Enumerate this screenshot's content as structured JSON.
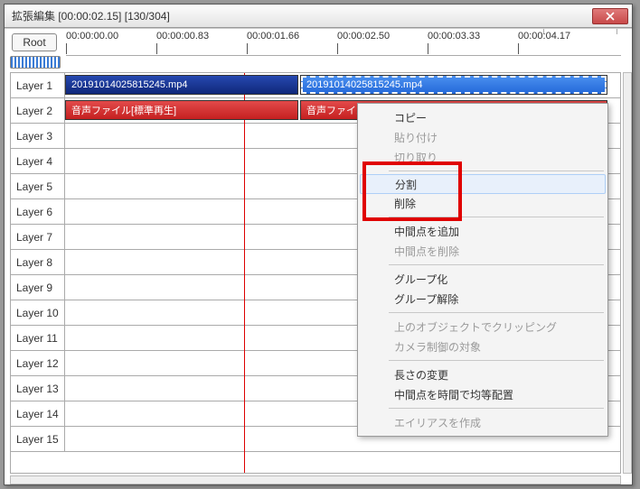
{
  "window": {
    "title": "拡張編集 [00:00:02.15] [130/304]"
  },
  "rootLabel": "Root",
  "ruler": [
    "00:00:00.00",
    "00:00:00.83",
    "00:00:01.66",
    "00:00:02.50",
    "00:00:03.33",
    "00:00:04.17"
  ],
  "layers": [
    "Layer 1",
    "Layer 2",
    "Layer 3",
    "Layer 4",
    "Layer 5",
    "Layer 6",
    "Layer 7",
    "Layer 8",
    "Layer 9",
    "Layer 10",
    "Layer 11",
    "Layer 12",
    "Layer 13",
    "Layer 14",
    "Layer 15"
  ],
  "clips": {
    "video_left": "20191014025815245.mp4",
    "video_right": "20191014025815245.mp4",
    "audio_left": "音声ファイル[標準再生]",
    "audio_right": "音声ファイル[標準再生]"
  },
  "menu": {
    "copy": "コピー",
    "paste": "貼り付け",
    "cut": "切り取り",
    "split": "分割",
    "delete": "削除",
    "addMid": "中間点を追加",
    "delMid": "中間点を削除",
    "group": "グループ化",
    "ungroup": "グループ解除",
    "clipAbove": "上のオブジェクトでクリッピング",
    "camera": "カメラ制御の対象",
    "length": "長さの変更",
    "evenMid": "中間点を時間で均等配置",
    "alias": "エイリアスを作成"
  }
}
